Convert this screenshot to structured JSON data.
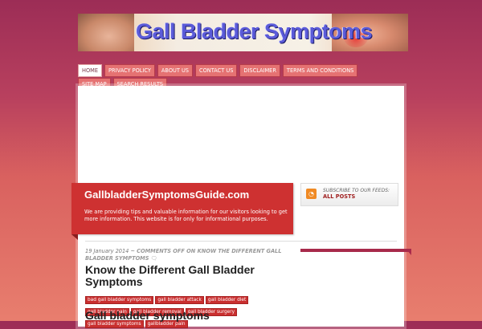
{
  "banner": {
    "title": "Gall Bladder Symptoms"
  },
  "nav": {
    "tabs": [
      {
        "label": "Home",
        "active": true
      },
      {
        "label": "Privacy Policy"
      },
      {
        "label": "About Us"
      },
      {
        "label": "Contact Us"
      },
      {
        "label": "Disclaimer"
      },
      {
        "label": "Terms and Conditions"
      },
      {
        "label": "Site Map"
      },
      {
        "label": "Search Results"
      }
    ]
  },
  "site": {
    "name": "GallbladderSymptomsGuide.com",
    "description": "We are providing tips and valuable information for our visitors looking to get more information. This website is for only for informational purposes."
  },
  "feed": {
    "icon": "rss-icon",
    "caption": "SUBSCRIBE TO OUR FEEDS:",
    "link": "ALL POSTS"
  },
  "post": {
    "date": "19 January 2014",
    "separator": "~",
    "comments": "Comments Off on Know the Different Gall Bladder Symptoms",
    "comment_icon": "comment-bubble-icon",
    "title": "Know the Different Gall Bladder Symptoms",
    "tags": [
      "bad gall bladder symptoms",
      "gall bladder attack",
      "gall bladder diet",
      "gall bladder pain",
      "gall bladder removal",
      "gall bladder surgery",
      "gall bladder symptoms",
      "gallbladder pain"
    ],
    "subheading": "Gall bladder symptoms"
  },
  "colors": {
    "accent_red": "#ce3131",
    "nav_tab": "#e57272",
    "sidebar_bar": "#a82a4b",
    "banner_title": "#5b5bd9"
  }
}
